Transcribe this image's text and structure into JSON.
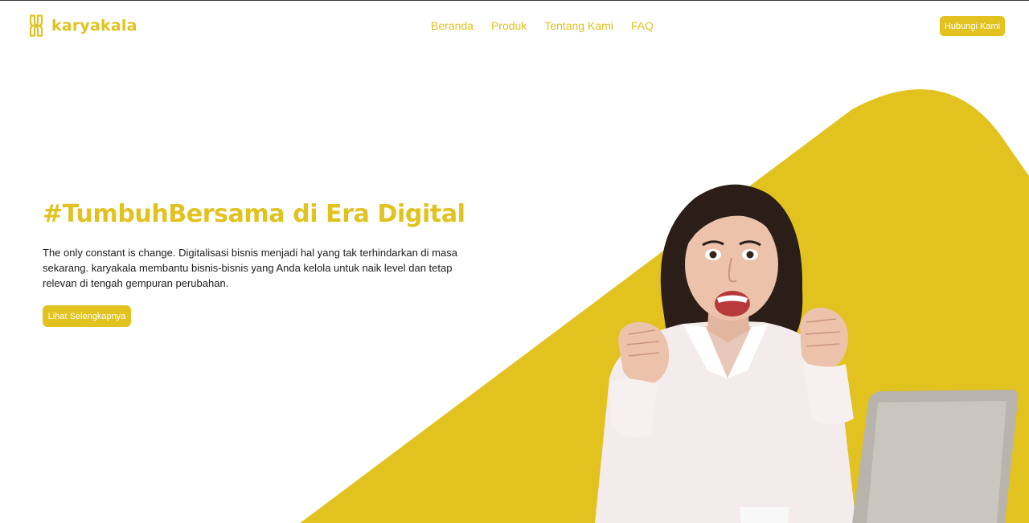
{
  "brand": {
    "name": "karyakala",
    "logo_icon": "karyakala-logo-mark",
    "accent_color": "#e1c21f"
  },
  "nav": {
    "items": [
      {
        "label": "Beranda"
      },
      {
        "label": "Produk"
      },
      {
        "label": "Tentang Kami"
      },
      {
        "label": "FAQ"
      }
    ],
    "contact_button": "Hubungi Kami"
  },
  "hero": {
    "title": "#TumbuhBersama di Era Digital",
    "description": "The only constant is change. Digitalisasi bisnis menjadi hal yang tak terhindarkan di masa sekarang. karyakala membantu bisnis-bisnis yang Anda kelola untuk naik level dan tetap relevan di tengah gempuran perubahan.",
    "cta_label": "Lihat Selengkapnya",
    "image": "excited-woman-with-laptop-photo"
  },
  "colors": {
    "accent": "#e1c21f",
    "text": "#1c1c1c",
    "background": "#ffffff"
  }
}
